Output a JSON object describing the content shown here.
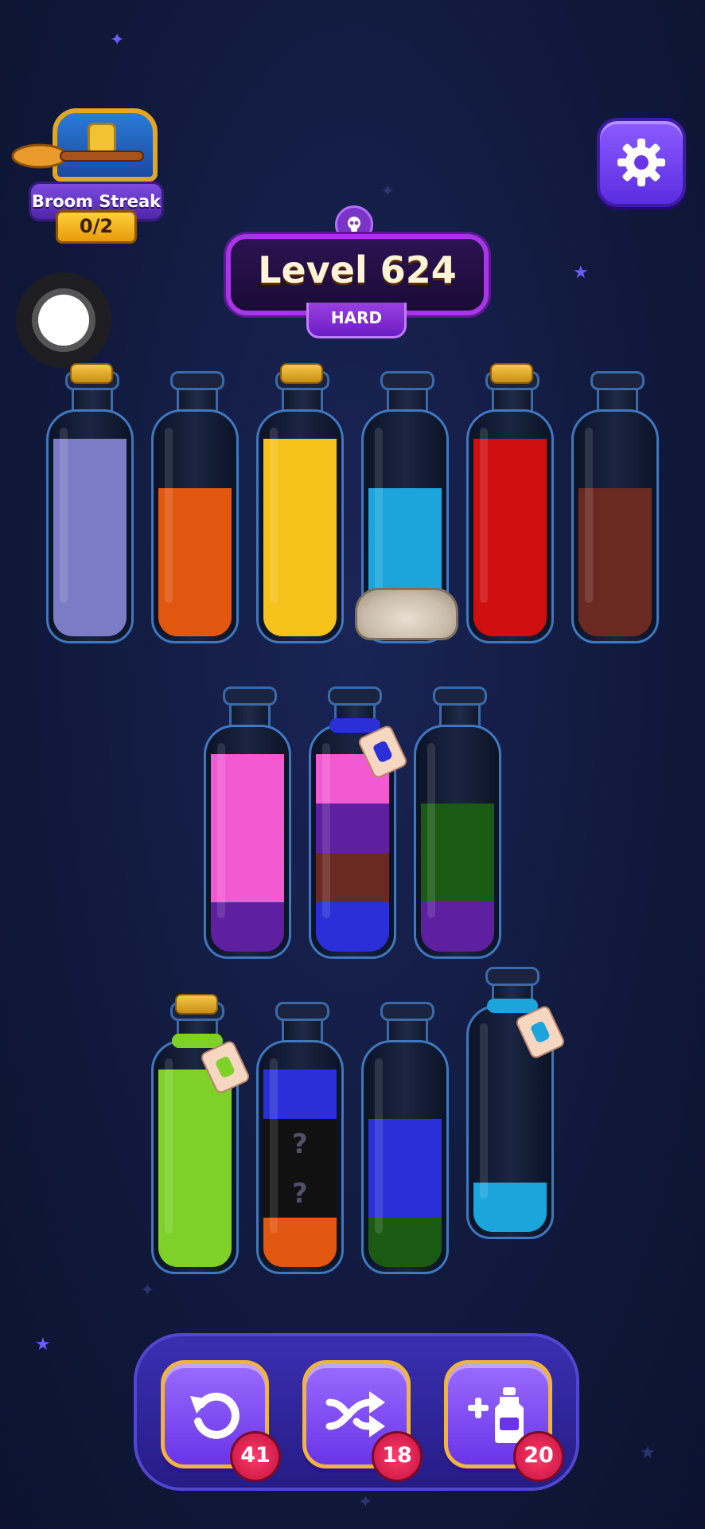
{
  "header": {
    "streak_label": "Broom Streak",
    "streak_count": "0/2",
    "level_title": "Level 624",
    "difficulty": "HARD"
  },
  "icons": {
    "settings": "gear-icon",
    "level_marker": "skull-icon",
    "undo": "undo-icon",
    "shuffle": "shuffle-icon",
    "add_bottle": "add-bottle-icon"
  },
  "actions": {
    "undo_count": "41",
    "shuffle_count": "18",
    "add_bottle_count": "20"
  },
  "colors": {
    "lavender": "#7b7cc6",
    "orange": "#e2570f",
    "yellow": "#f6c21c",
    "cyan": "#1ba5dc",
    "red": "#cf0f0f",
    "brown": "#6a2a22",
    "pink": "#f25ad2",
    "purple": "#5e1fa0",
    "blue": "#2a2fd8",
    "green": "#1a5a12",
    "lime": "#7fd12a",
    "hidden": "#111"
  },
  "bottles": {
    "row1": [
      {
        "layers": [
          "lavender",
          "lavender",
          "lavender",
          "lavender"
        ],
        "cork": true
      },
      {
        "layers": [
          "orange",
          "orange",
          "orange"
        ],
        "cork": false
      },
      {
        "layers": [
          "yellow",
          "yellow",
          "yellow",
          "yellow"
        ],
        "cork": true
      },
      {
        "layers": [
          "cyan",
          "cyan",
          "cyan"
        ],
        "cork": false,
        "rocks": true
      },
      {
        "layers": [
          "red",
          "red",
          "red",
          "red"
        ],
        "cork": true
      },
      {
        "layers": [
          "brown",
          "brown",
          "brown"
        ],
        "cork": false
      }
    ],
    "row2": [
      {
        "layers": [
          "purple",
          "pink",
          "pink",
          "pink"
        ],
        "cork": false
      },
      {
        "layers": [
          "blue",
          "brown",
          "purple",
          "pink"
        ],
        "cork": false,
        "rope": "blue",
        "tag": "blue"
      },
      {
        "layers": [
          "purple",
          "green",
          "green"
        ],
        "cork": false
      }
    ],
    "row3": [
      {
        "layers": [
          "lime",
          "lime",
          "lime",
          "lime"
        ],
        "cork": true,
        "rope": "lime",
        "tag": "lime"
      },
      {
        "layers": [
          "orange",
          "hidden",
          "hidden",
          "blue"
        ],
        "cork": false,
        "hidden_marks": "?"
      },
      {
        "layers": [
          "green",
          "blue",
          "blue"
        ],
        "cork": false
      },
      {
        "layers": [
          "cyan"
        ],
        "cork": false,
        "rope": "cyan",
        "tag": "cyan"
      }
    ]
  }
}
